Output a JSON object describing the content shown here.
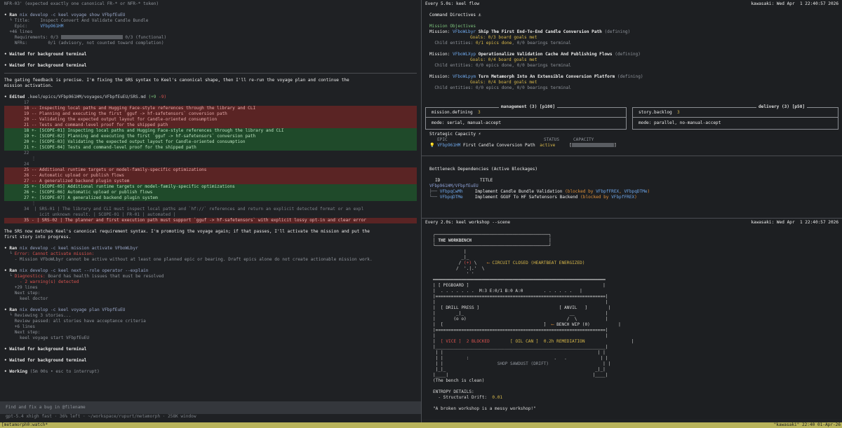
{
  "left": {
    "intro_line": "NFR-03' (expected exactly one canonical FR-* or NFR-* token)",
    "ran1": {
      "label": "Ran",
      "cmd": "nix develop -c keel voyage show VFbpfEuEU"
    },
    "ran1_out": {
      "title_k": "Title:",
      "title_v": "Inspect Convert And Validate Candle Bundle",
      "epic_k": "Epic:",
      "epic_v": "VFbp961HM",
      "more": "+46 lines",
      "req_k": "Requirements:",
      "req_a": "0/3",
      "req_b": "0/3 (functional)",
      "nfr_k": "NFRs:",
      "nfr_v": "0/1 (advisory, not counted toward completion)"
    },
    "wait1": "Waited for background terminal",
    "wait2": "Waited for background terminal",
    "para1a": "The gating feedback is precise. I'm fixing the SRS syntax to Keel's canonical shape, then I'll re-run the voyage plan and continue the",
    "para1b": "mission activation.",
    "edited": {
      "label": "Edited",
      "path": ".keel/epics/VFbp961HM/voyages/VFbpfEuEU/SRS.md",
      "added": "(+9",
      "removed": "-9)"
    },
    "diff": [
      {
        "kind": "ctx",
        "text": "17"
      },
      {
        "kind": "del",
        "text": "18 -- Inspecting local paths and Hugging Face-style references through the library and CLI"
      },
      {
        "kind": "del",
        "text": "19 -- Planning and executing the first `gguf -> hf-safetensors` conversion path"
      },
      {
        "kind": "del",
        "text": "20 -- Validating the expected output layout for Candle-oriented consumption"
      },
      {
        "kind": "del",
        "text": "21 -- Tests and command-level proof for the shipped path"
      },
      {
        "kind": "add",
        "text": "18 +- [SCOPE-01] Inspecting local paths and Hugging Face-style references through the library and CLI"
      },
      {
        "kind": "add",
        "text": "19 +- [SCOPE-02] Planning and executing the first `gguf -> hf-safetensors` conversion path"
      },
      {
        "kind": "add",
        "text": "20 +- [SCOPE-03] Validating the expected output layout for Candle-oriented consumption"
      },
      {
        "kind": "add",
        "text": "21 +- [SCOPE-04] Tests and command-level proof for the shipped path"
      },
      {
        "kind": "ctx",
        "text": "22"
      },
      {
        "kind": "ctx",
        "text": "   ⋮"
      },
      {
        "kind": "ctx",
        "text": "24"
      },
      {
        "kind": "del",
        "text": "25 -- Additional runtime targets or model-family-specific optimizations"
      },
      {
        "kind": "del",
        "text": "26 -- Automatic upload or publish flows"
      },
      {
        "kind": "del",
        "text": "27 -- A generalized backend plugin system"
      },
      {
        "kind": "add",
        "text": "25 +- [SCOPE-05] Additional runtime targets or model-family-specific optimizations"
      },
      {
        "kind": "add",
        "text": "26 +- [SCOPE-06] Automatic upload or publish flows"
      },
      {
        "kind": "add",
        "text": "27 +- [SCOPE-07] A generalized backend plugin system"
      },
      {
        "kind": "ctx",
        "text": "   ⋮"
      },
      {
        "kind": "ctx",
        "text": "34  | SRS-01 | The library and CLI must inspect local paths and `hf://` references and return an explicit detected format or an expl"
      },
      {
        "kind": "ctx",
        "text": "      icit unknown result. | SCOPE-01 | FR-01 | automated |"
      },
      {
        "kind": "hl",
        "text": "35 - | SRS-02 | The planner and first execution path must support `gguf -> hf-safetensors` with explicit lossy opt-in and clear error"
      }
    ],
    "para2a": "The SRS now matches Keel's canonical requirement syntax. I'm promoting the voyage again; if that passes, I'll activate the mission and put the",
    "para2b": "first story into progress.",
    "ran2": {
      "label": "Ran",
      "cmd": "nix develop -c keel mission activate VFboWLbyr"
    },
    "ran2_out": {
      "err": "Error: Cannot activate mission:",
      "detail": "- Mission VFboWLbyr cannot be active without at least one planned epic or bearing. Draft epics alone do not create actionable mission work."
    },
    "ran3": {
      "label": "Ran",
      "cmd": "nix develop -c keel next --role operator --explain"
    },
    "ran3_out": {
      "diag_k": "Diagnostics:",
      "diag_v": "Board has health issues that must be resolved",
      "warn": "- 2 warning(s) detected",
      "more": "+29 lines",
      "next": "Next step:",
      "next_v": "keel doctor"
    },
    "ran4": {
      "label": "Ran",
      "cmd": "nix develop -c keel voyage plan VFbpfEuEU"
    },
    "ran4_out": {
      "l1": "Reviewing 3 stories...",
      "l2": "Review passed: all stories have acceptance criteria",
      "more": "+6 lines",
      "next": "Next step:",
      "next_v": "keel voyage start VFbpfEuEU"
    },
    "wait3": "Waited for background terminal",
    "wait4": "Waited for background terminal",
    "working": "Working",
    "working_meta": "(5m 00s • esc to interrupt)",
    "input_placeholder": "Find and fix a bug in @filename",
    "meta": "gpt-5.4 xhigh fast · 36% left · ~/workspace/rupurt/metamorph · 258K window"
  },
  "flow": {
    "header_cmd": "Every 5.0s: keel flow",
    "header_host": "kawasaki: Wed Apr  1 22:40:57 2026",
    "directives": "Command Directives ⚓",
    "objectives": "Mission Objectives",
    "missions": [
      {
        "label": "Mission:",
        "id": "VFboWLbyr",
        "title": "Ship The First End-To-End Candle Conversion Path",
        "state": "(defining)",
        "goals": "Goals: 0/3 board goals met",
        "children_k": "Child entities:",
        "children_v": "0/1 epics done",
        "children_b": ", 0/0 bearings terminal"
      },
      {
        "label": "Mission:",
        "id": "VFboWLXyp",
        "title": "Operationalize Validation Cache And Publishing Flows",
        "state": "(defining)",
        "goals": "Goals: 0/4 board goals met",
        "children_k": "Child entities:",
        "children_v": "0/0 epics done",
        "children_b": ", 0/0 bearings terminal"
      },
      {
        "label": "Mission:",
        "id": "VFboWLpym",
        "title": "Turn Metamorph Into An Extensible Conversion Platform",
        "state": "(defining)",
        "goals": "Goals: 0/4 board goals met",
        "children_k": "Child entities:",
        "children_v": "0/0 epics done",
        "children_b": ", 0/0 bearings terminal"
      }
    ],
    "management": {
      "title": "management (3) [p100]",
      "row1_k": "mission.defining",
      "row1_v": "3",
      "row2": "mode: serial, manual-accept"
    },
    "delivery": {
      "title": "delivery (3) [p50]",
      "row1_k": "story.backlog",
      "row1_v": "3",
      "row2": "mode: parallel, no-manual-accept"
    },
    "capacity": {
      "title": "Strategic Capacity ⚡",
      "col_epic": "EPIC",
      "col_status": "STATUS",
      "col_capacity": "CAPACITY",
      "epic_id": "VFbp961HM",
      "epic_title": "First Candle Conversion Path",
      "status": "active",
      "bar_open": "[",
      "bar_close": "]"
    },
    "bottleneck": {
      "title": "Bottleneck Dependencies (Active Blockages)",
      "col_id": "ID",
      "col_title": "TITLE",
      "root": "VFbp961HM/VFbpfEuEU",
      "rows": [
        {
          "id": "VFbpqCwMh",
          "title": "Implement Candle Bundle Validation",
          "blocked_pre": "(blocked by ",
          "b1": "VFbpfFREX",
          "sep": ", ",
          "b2": "VFbpqDTMe",
          "blocked_post": ")"
        },
        {
          "id": "VFbpqDTMe",
          "title": "Implement GGUF To HF Safetensors Backend",
          "blocked_pre": "(blocked by ",
          "b1": "VFbpfFREX",
          "sep": "",
          "b2": "",
          "blocked_post": ")"
        }
      ]
    }
  },
  "workshop": {
    "header_cmd": "Every 2.0s: keel workshop --scene",
    "header_host": "kawasaki: Wed Apr  1 22:40:57 2026",
    "title": "THE WORKBENCH",
    "circuit": "CIRCUIT CLOSED (HEARTBEAT ENERGIZED)",
    "pegboard": "[ PEGBOARD ]",
    "pegboard_row": ". . . . . . .  M:3 E:0/1 B:0 A:0        . . . . . .",
    "drill": "[ DRILL PRESS ]",
    "anvil": "[ ANVIL   ]",
    "bench_wip": "BENCH WIP (0)",
    "vice": "[ VICE ]",
    "blocked": "2 BLOCKED",
    "oil": "[ OIL CAN ]",
    "remediation": "0.2h REMEDIATION",
    "sawdust": "SHOP SAWDUST (DRIFT)",
    "clean": "(The bench is clean)",
    "entropy": "ENTROPY DETAILS:",
    "drift_k": "- Structural Drift:",
    "drift_v": "0.01",
    "quote": "\"A broken workshop is a messy workshop!\""
  },
  "status": {
    "left": "[metamorph0:watch*",
    "right": "\"kawasaki\" 22:40 01-Apr-26"
  },
  "colors": {
    "accent_blue": "#6ea6e8",
    "status_bar": "#b8b35a",
    "diff_del": "#5a2424",
    "diff_add": "#1f4a2a"
  }
}
